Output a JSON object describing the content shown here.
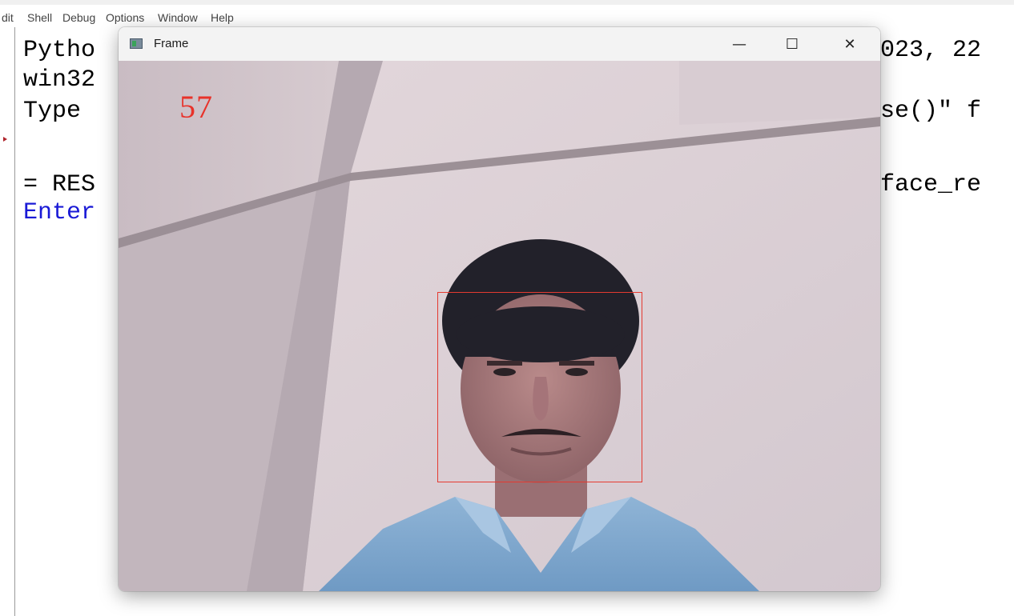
{
  "idle": {
    "menu": [
      "dit",
      "Shell",
      "Debug",
      "Options",
      "Window",
      "Help"
    ],
    "left_lines": [
      "Pytho",
      "win32",
      "Type",
      "= RES",
      "Enter"
    ],
    "right_lines": [
      "023, 22",
      "se()\" f",
      "face_re"
    ]
  },
  "frame_window": {
    "title": "Frame",
    "controls": {
      "minimize": "—",
      "maximize": "☐",
      "close": "✕"
    },
    "overlay_text": "57"
  },
  "colors": {
    "overlay": "#e8322a",
    "face_box": "#e53a30",
    "prompt_blue": "#1a1ad6"
  }
}
